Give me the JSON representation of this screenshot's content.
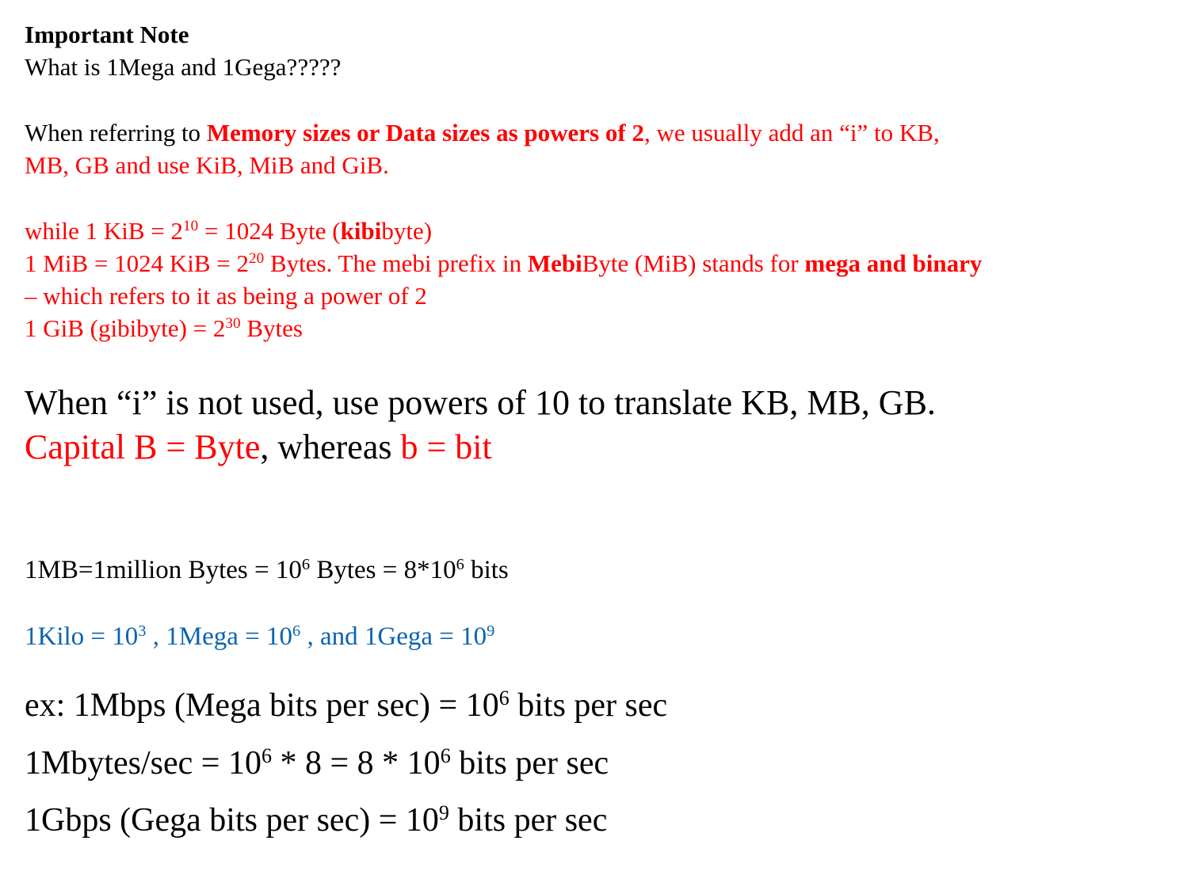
{
  "colors": {
    "text": "#000000",
    "red": "#ff0000",
    "blue": "#0b63b0",
    "background": "#ffffff"
  },
  "title": "Important Note",
  "question": "What is 1Mega and 1Gega?????",
  "intro": {
    "part1": "When referring to ",
    "highlight": "Memory sizes or Data sizes as powers of 2",
    "part2": ", we usually add an “i” to KB,",
    "line2": "MB, GB and use KiB, MiB and GiB."
  },
  "binary": {
    "kib_prefix": "while 1 KiB = 2",
    "kib_exp": "10",
    "kib_mid": " = 1024 Byte (",
    "kib_bold": "kibi",
    "kib_end": "byte)",
    "mib_prefix": "1 MiB = 1024 KiB = 2",
    "mib_exp": "20",
    "mib_mid": " Bytes. The mebi prefix in ",
    "mib_bold1": "Mebi",
    "mib_mid2": "Byte (MiB) stands for ",
    "mib_bold2": "mega and binary",
    "mib_cont": "– which refers to it as being a power of 2",
    "gib_prefix": "1 GiB (gibibyte) = 2",
    "gib_exp": "30",
    "gib_end": " Bytes"
  },
  "decimal_note": "When “i” is not used, use powers of 10 to translate KB, MB, GB.",
  "capital": {
    "cap": "Capital B = Byte",
    "whereas": ", whereas ",
    "bit": "b = bit"
  },
  "mb_line": {
    "p1": "1MB=1million Bytes = 10",
    "e1": "6",
    "p2": " Bytes  = 8*10",
    "e2": "6",
    "p3": " bits"
  },
  "prefixes": {
    "kilo": "1Kilo = 10",
    "kilo_exp": "3",
    "mega": " , 1Mega = 10",
    "mega_exp": "6",
    "gega": " ,  and 1Gega = 10",
    "gega_exp": "9"
  },
  "examples": {
    "ex1_a": "ex: 1Mbps (Mega bits per sec) = 10",
    "ex1_exp": "6",
    "ex1_b": " bits per sec",
    "ex2_a": "1Mbytes/sec = 10",
    "ex2_exp1": "6",
    "ex2_b": " * 8 = 8 * 10",
    "ex2_exp2": "6",
    "ex2_c": " bits per sec",
    "ex3_a": "1Gbps (Gega bits per sec) = 10",
    "ex3_exp": "9",
    "ex3_b": " bits per sec"
  }
}
